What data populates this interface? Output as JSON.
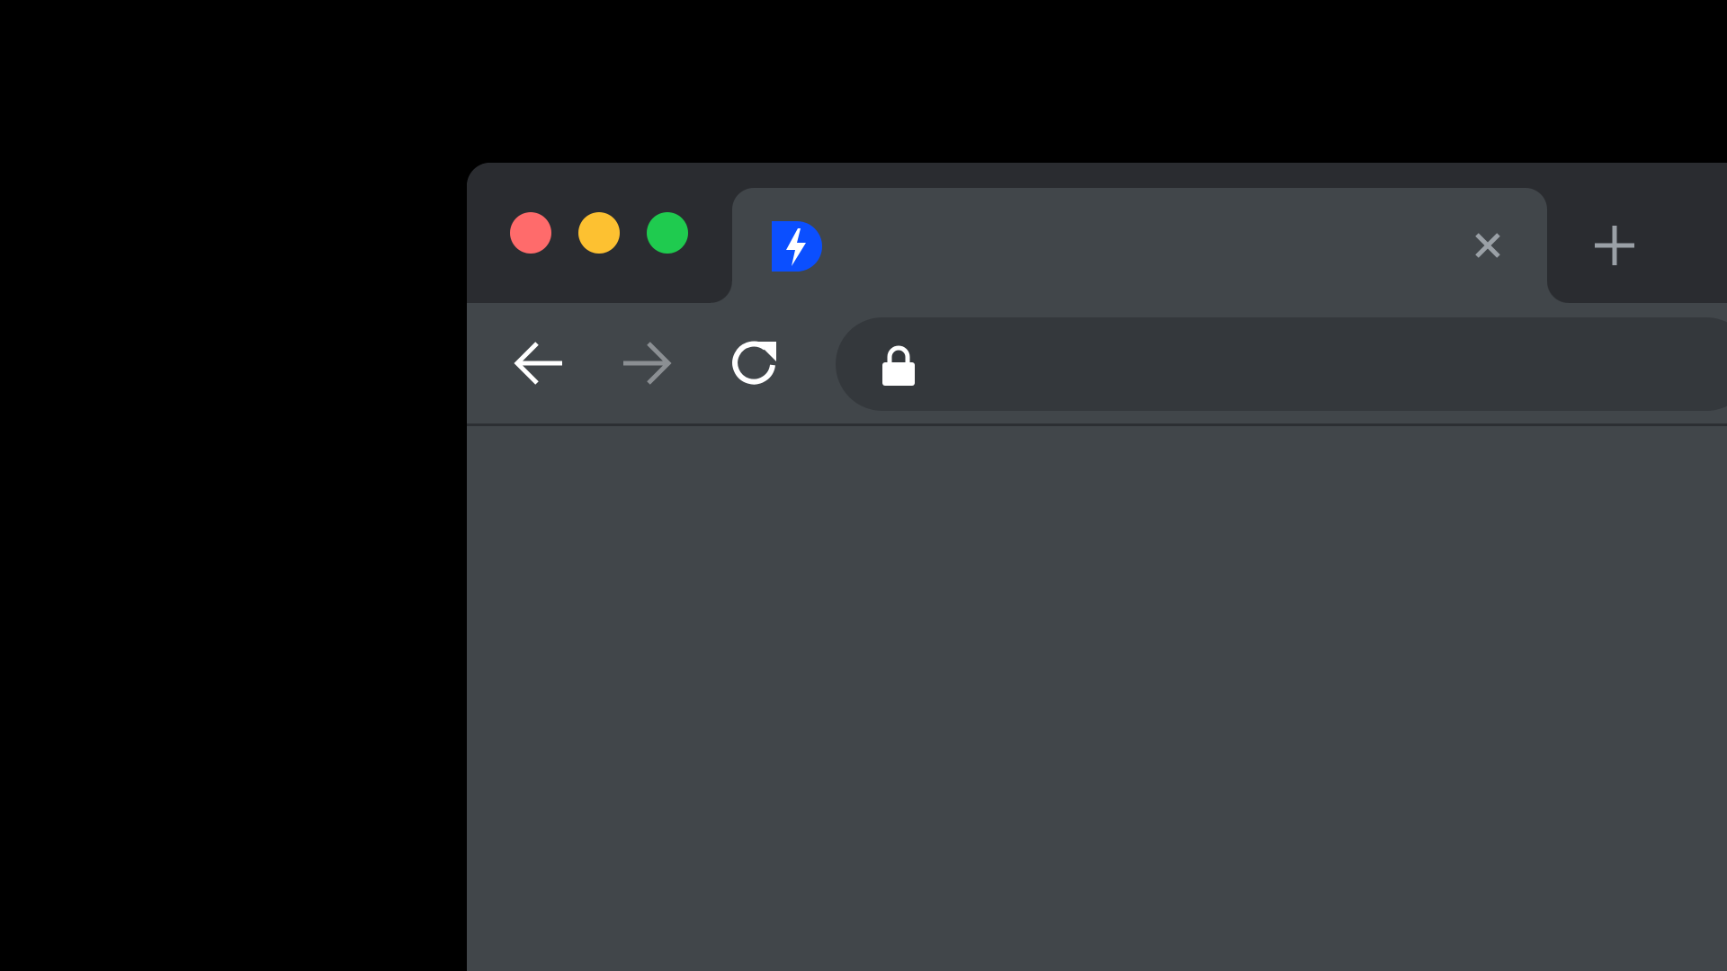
{
  "colors": {
    "background": "#000000",
    "titlebar": "#2a2c30",
    "tab_active": "#41464a",
    "toolbar": "#41464a",
    "omnibox": "#34383c",
    "traffic_close": "#ff6159",
    "traffic_minimize": "#ffbd2e",
    "traffic_maximize": "#28c840",
    "favicon_blue": "#0b4fff",
    "icon_white": "#ffffff",
    "icon_gray": "#9aa0a6"
  },
  "icons": {
    "traffic_close": "red-close-circle",
    "traffic_minimize": "yellow-minimize-circle",
    "traffic_maximize": "green-maximize-circle",
    "favicon": "blue-d-lightning-logo",
    "tab_close": "close-x-icon",
    "new_tab": "plus-icon",
    "back": "arrow-left-icon",
    "forward": "arrow-right-icon",
    "reload": "reload-icon",
    "lock": "lock-icon"
  },
  "tab": {
    "title": ""
  },
  "omnibox": {
    "value": "",
    "placeholder": ""
  }
}
